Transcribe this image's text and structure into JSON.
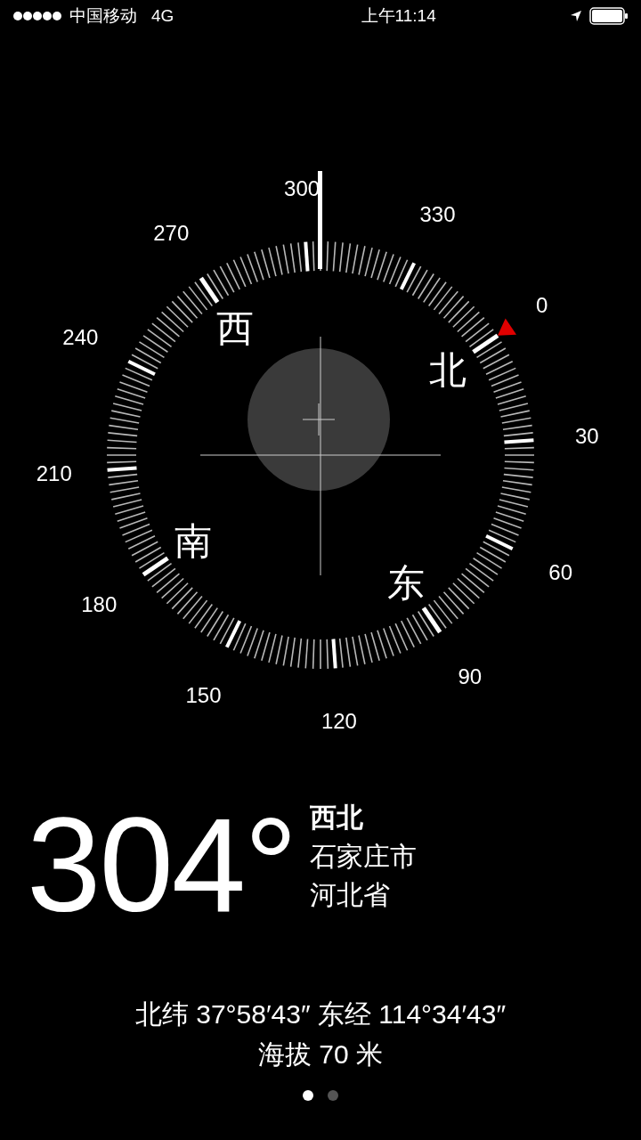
{
  "status_bar": {
    "carrier": "中国移动",
    "network": "4G",
    "time": "上午11:14"
  },
  "compass": {
    "degree_labels": [
      "0",
      "30",
      "60",
      "90",
      "120",
      "150",
      "180",
      "210",
      "240",
      "270",
      "300",
      "330"
    ],
    "cardinals": [
      "北",
      "东",
      "南",
      "西"
    ]
  },
  "reading": {
    "heading": "304°",
    "direction": "西北",
    "city": "石家庄市",
    "province": "河北省"
  },
  "location": {
    "coordinates": "北纬 37°58′43″  东经 114°34′43″",
    "altitude": "海拔 70 米"
  },
  "pages": [
    {
      "selected": true
    },
    {
      "selected": false
    }
  ]
}
